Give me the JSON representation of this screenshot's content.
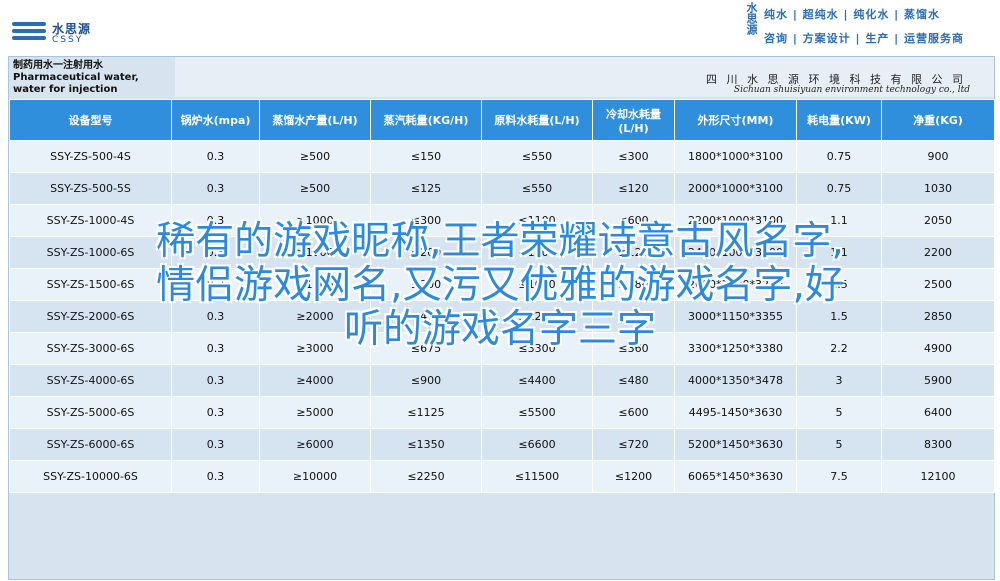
{
  "header": {
    "logo_cn": "水思源",
    "logo_en": "CSSY",
    "tag_vertical": "水思源",
    "tagline_row1": "纯水 | 超纯水 | 纯化水 | 蒸馏水",
    "tagline_row2": "咨询 | 方案设计 | 生产 | 运营服务商"
  },
  "table": {
    "product_title_cn": "制药用水一注射用水",
    "product_title_en": "Pharmaceutical water, water for injection",
    "company_cn": "四 川 水 思 源 环 境 科 技 有 限 公 司",
    "company_en": "Sichuan shuisiyuan environment technology co., ltd",
    "headers": [
      "设备型号",
      "锅炉水(mpa)",
      "蒸馏水产量(L/H)",
      "蒸汽耗量(KG/H)",
      "原料水耗量(L/H)",
      "冷却水耗量(L/H)",
      "外形尺寸(MM)",
      "耗电量(KW)",
      "净重(KG)"
    ],
    "rows": [
      [
        "SSY-ZS-500-4S",
        "0.3",
        "≥500",
        "≤150",
        "≤550",
        "≤300",
        "1800*1000*3100",
        "0.75",
        "900"
      ],
      [
        "SSY-ZS-500-5S",
        "0.3",
        "≥500",
        "≤125",
        "≤550",
        "≤120",
        "2000*1000*3100",
        "0.75",
        "1030"
      ],
      [
        "SSY-ZS-1000-4S",
        "0.3",
        "≥1000",
        "≤300",
        "≤1100",
        "≤600",
        "2200*1000*3100",
        "1.1",
        "2050"
      ],
      [
        "SSY-ZS-1000-6S",
        "0.3",
        "≥1000",
        "≤200",
        "≤1100",
        "≤120",
        "2400*1000*3100",
        "1.1",
        "2200"
      ],
      [
        "SSY-ZS-1500-6S",
        "0.3",
        "≥1500",
        "≤300",
        "≤1650",
        "≤180",
        "2600*1000*3200",
        "1.5",
        "2500"
      ],
      [
        "SSY-ZS-2000-6S",
        "0.3",
        "≥2000",
        "≤450",
        "≤2200",
        "≤240",
        "3000*1150*3355",
        "1.5",
        "2850"
      ],
      [
        "SSY-ZS-3000-6S",
        "0.3",
        "≥3000",
        "≤675",
        "≤3300",
        "≤360",
        "3300*1250*3380",
        "2.2",
        "4900"
      ],
      [
        "SSY-ZS-4000-6S",
        "0.3",
        "≥4000",
        "≤900",
        "≤4400",
        "≤480",
        "4000*1350*3478",
        "3",
        "5900"
      ],
      [
        "SSY-ZS-5000-6S",
        "0.3",
        "≥5000",
        "≤1125",
        "≤5500",
        "≤600",
        "4495-1450*3630",
        "5",
        "6400"
      ],
      [
        "SSY-ZS-6000-6S",
        "0.3",
        "≥6000",
        "≤1350",
        "≤6600",
        "≤720",
        "5200*1450*3630",
        "5",
        "8300"
      ],
      [
        "SSY-ZS-10000-6S",
        "0.3",
        "≥10000",
        "≤2250",
        "≤11500",
        "≤1200",
        "6065*1450*3630",
        "7.5",
        "12100"
      ]
    ]
  },
  "overlay": {
    "line1": "稀有的游戏昵称,王者荣耀诗意古风名字,",
    "line2": "情侣游戏网名,又污又优雅的游戏名字,好",
    "line3": "听的游戏名字三字"
  }
}
